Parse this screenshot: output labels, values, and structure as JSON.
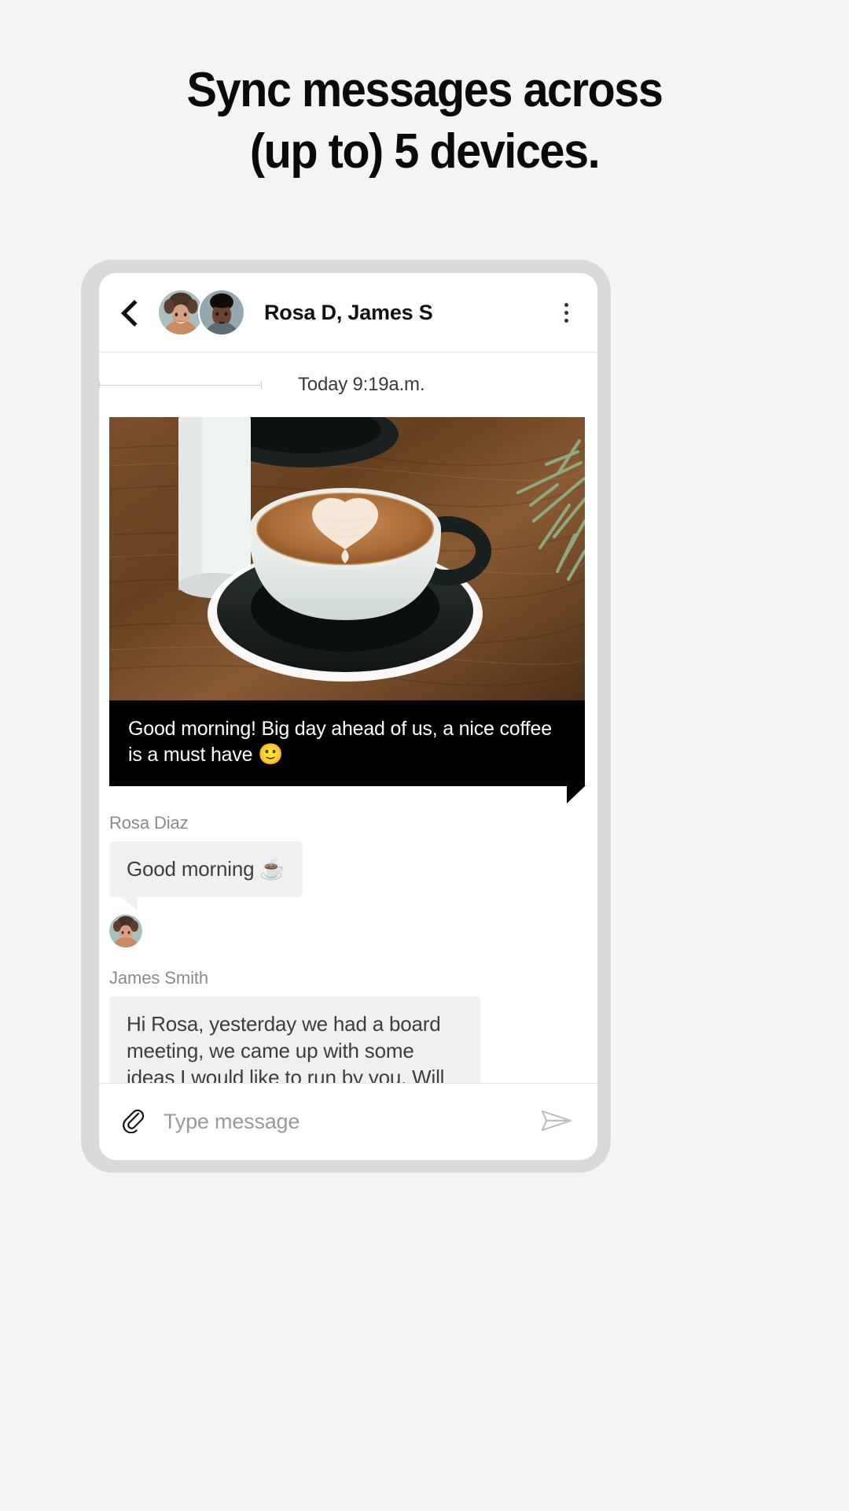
{
  "headline": {
    "line1": "Sync messages across",
    "line2": "(up to) 5 devices."
  },
  "chat": {
    "back_label": "Back",
    "title": "Rosa D, James S",
    "menu_label": "More options",
    "avatars": [
      {
        "name": "Rosa Diaz",
        "alt": "rosa-avatar"
      },
      {
        "name": "James Smith",
        "alt": "james-avatar"
      }
    ],
    "date_divider": "Today 9:19a.m.",
    "photo_message": {
      "image_alt": "Latte art coffee cup on wooden table",
      "caption": "Good morning! Big day ahead of us, a nice coffee is a must have ",
      "caption_emoji": "🙂"
    },
    "messages": [
      {
        "sender": "Rosa Diaz",
        "text": "Good morning ",
        "emoji": "☕",
        "avatar_alt": "rosa-avatar"
      },
      {
        "sender": "James Smith",
        "text": "Hi Rosa, yesterday we had a board meeting, we came up with some ideas I would like to run by you. Will send you an email shortly.",
        "emoji": "",
        "avatar_alt": "james-avatar"
      }
    ],
    "composer": {
      "attach_label": "Attach file",
      "placeholder": "Type message",
      "value": "",
      "send_label": "Send"
    }
  },
  "colors": {
    "page_bg": "#f4f4f4",
    "bezel": "#d8dada",
    "caption_bg": "#000000",
    "bubble_bg": "#f0f0f0",
    "sender_text": "#8a8a8a"
  }
}
